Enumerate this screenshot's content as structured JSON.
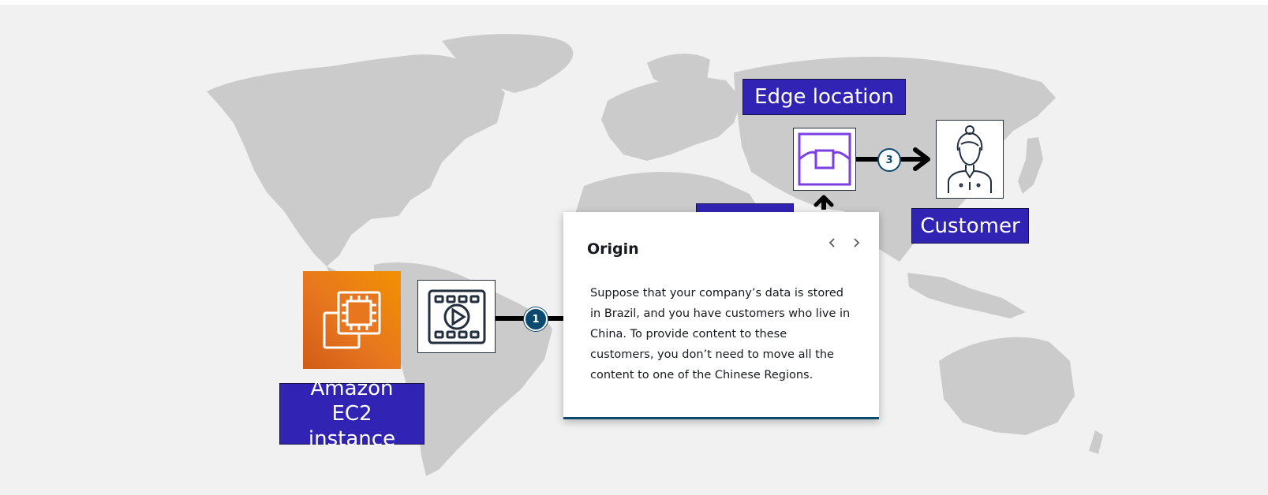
{
  "popover": {
    "title": "Origin",
    "body": "Suppose that your company’s data is stored in Brazil, and you have customers who live in China. To provide content to these customers, you don’t need to move all the content to one of the Chinese Regions.",
    "prev_icon": "chevron-left-icon",
    "next_icon": "chevron-right-icon"
  },
  "labels": {
    "ec2": "Amazon EC2 instance",
    "edge": "Edge location",
    "customer": "Customer"
  },
  "steps": {
    "step1": "1",
    "step3": "3"
  },
  "icons": {
    "ec2": "ec2-chip-icon",
    "video": "video-file-icon",
    "edge": "edge-location-icon",
    "customer": "customer-person-icon"
  },
  "colors": {
    "label_fill": "#3124b4",
    "edge_icon": "#7b3fe4",
    "badge": "#0b4a6f",
    "ec2_orange": "#e7761f",
    "map_land": "#cbcbcb",
    "background": "#f1f1f1"
  }
}
